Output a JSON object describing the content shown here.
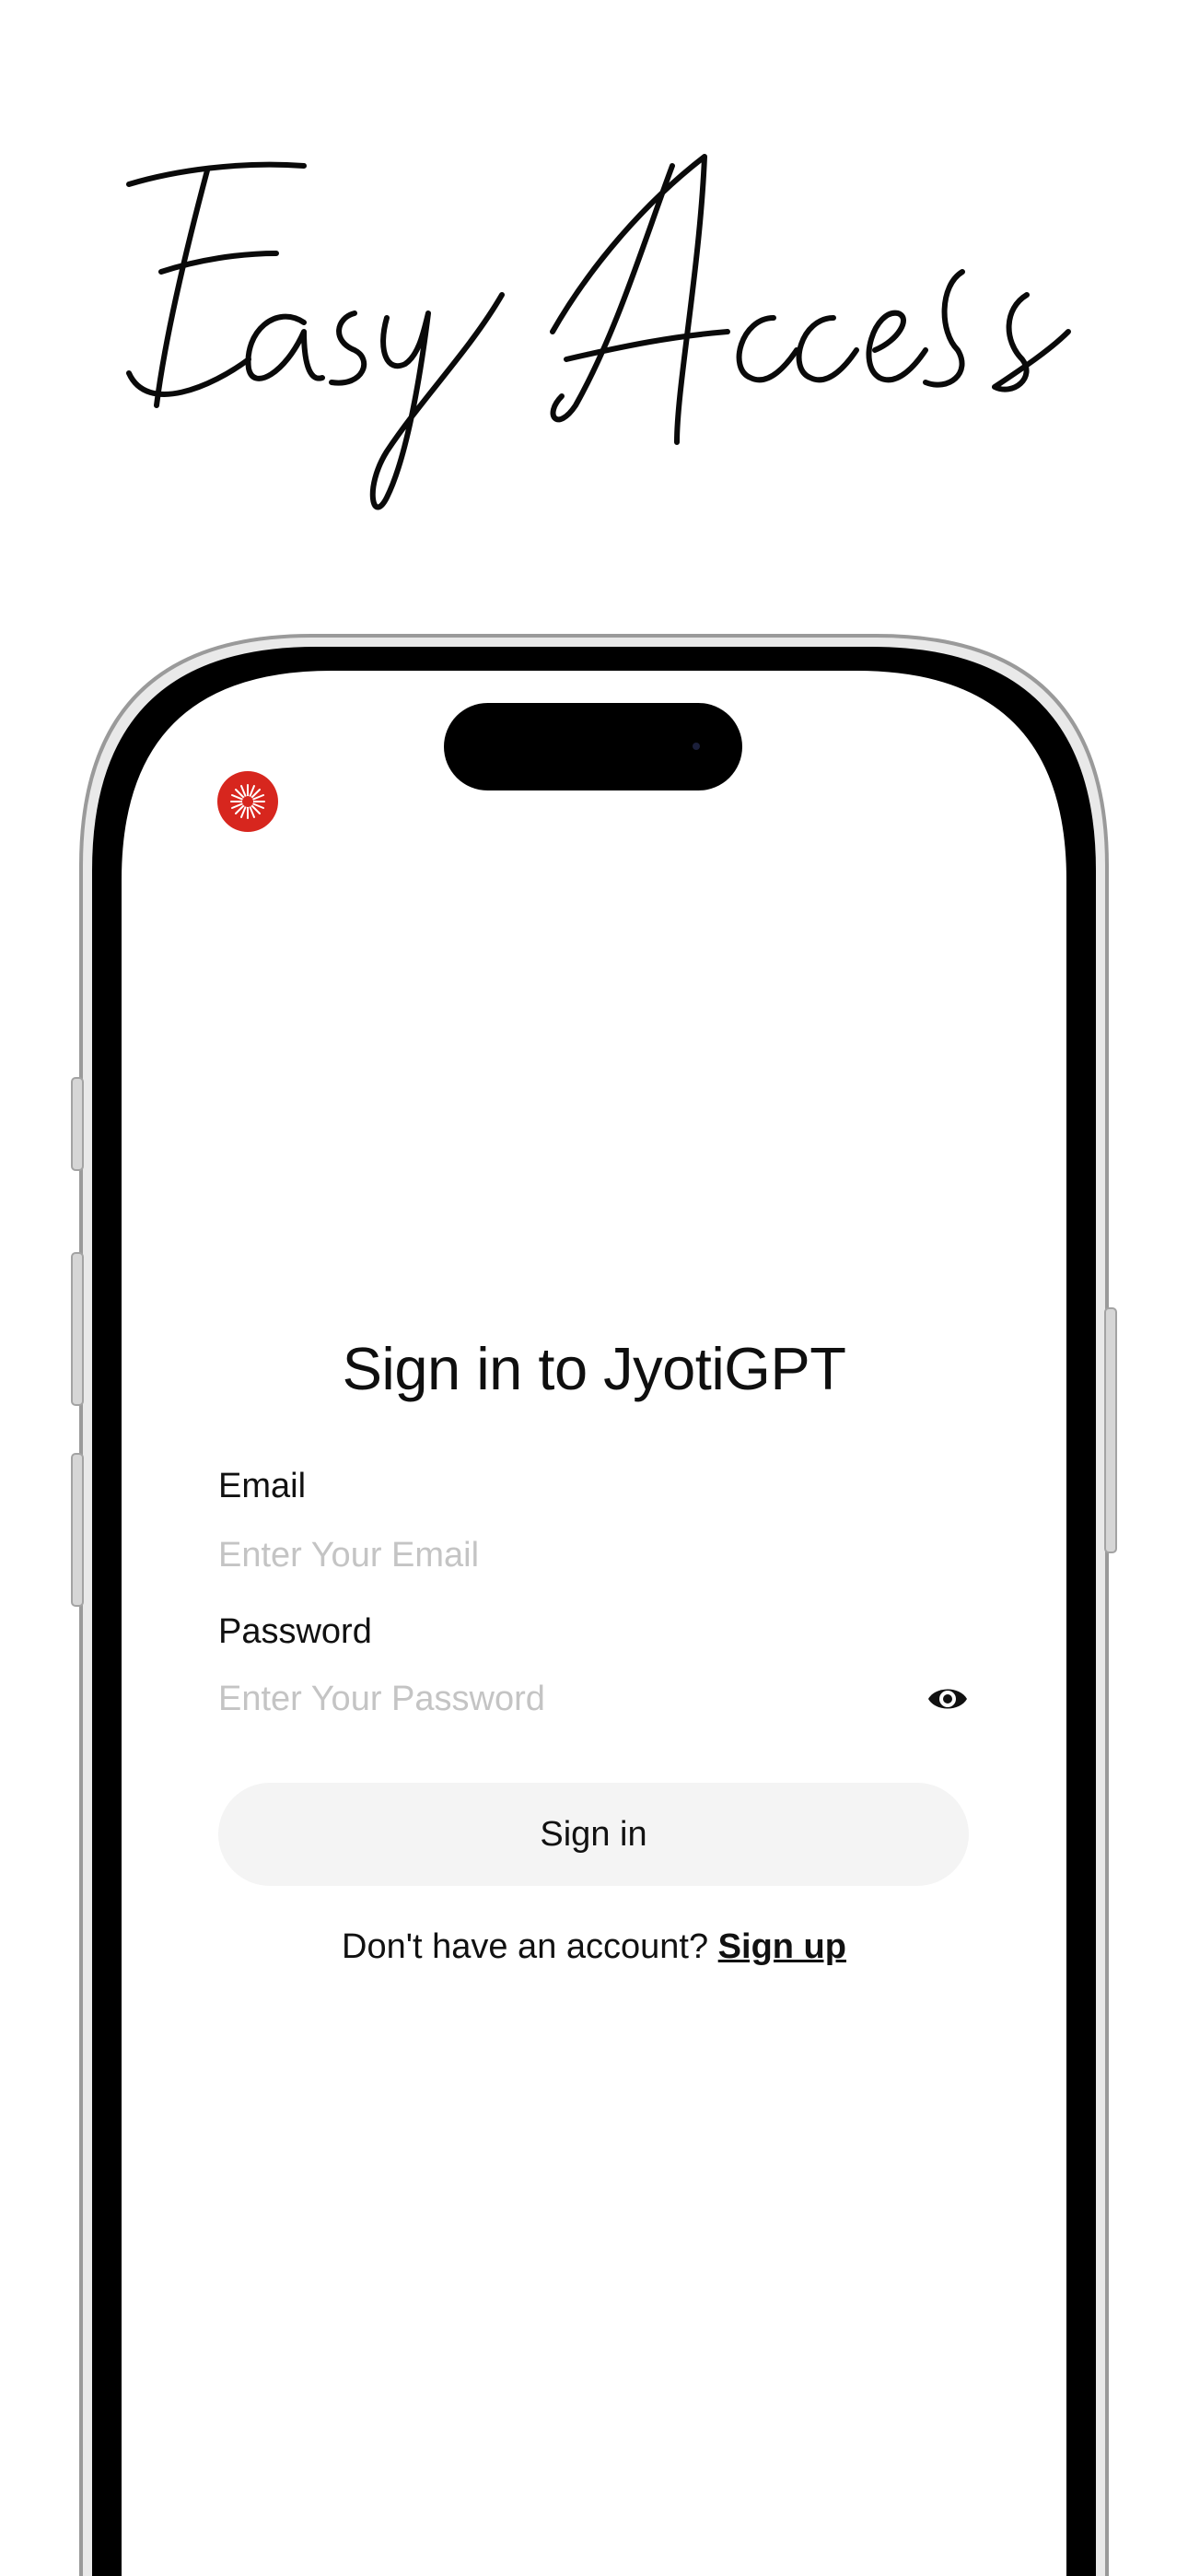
{
  "headline": "Easy Access",
  "app": {
    "logo_icon": "jyoti-sunburst-logo-icon",
    "accent_color": "#d7261e"
  },
  "signin": {
    "title": "Sign in to JyotiGPT",
    "email_label": "Email",
    "email_placeholder": "Enter Your Email",
    "password_label": "Password",
    "password_placeholder": "Enter Your Password",
    "show_password_icon": "eye-icon",
    "submit_label": "Sign in",
    "no_account_text": "Don't have an account?",
    "signup_link": "Sign up"
  }
}
